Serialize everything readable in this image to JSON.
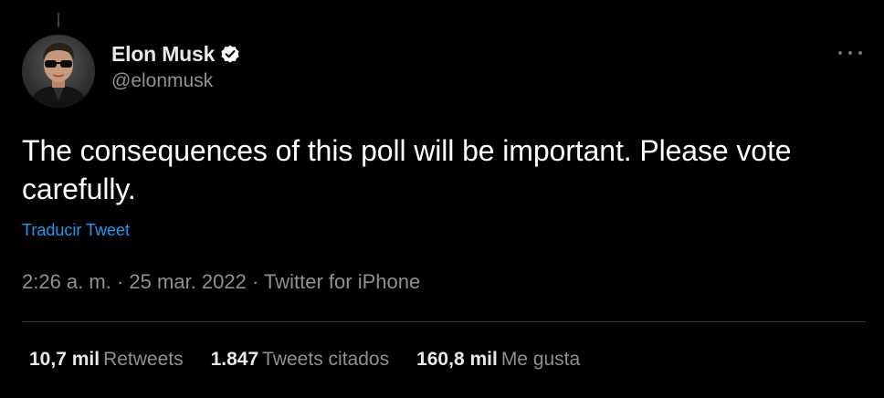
{
  "author": {
    "display_name": "Elon Musk",
    "handle": "@elonmusk",
    "verified": true
  },
  "tweet": {
    "text": "The consequences of this poll will be important. Please vote carefully.",
    "translate_label": "Traducir Tweet",
    "time": "2:26 a. m.",
    "date": "25 mar. 2022",
    "source": "Twitter for iPhone",
    "separator": "·"
  },
  "stats": {
    "retweets_count": "10,7 mil",
    "retweets_label": "Retweets",
    "quotes_count": "1.847",
    "quotes_label": "Tweets citados",
    "likes_count": "160,8 mil",
    "likes_label": "Me gusta"
  },
  "icons": {
    "verified": "verified-badge-icon",
    "more": "more-horizontal-icon"
  },
  "colors": {
    "background": "#000000",
    "text": "#ffffff",
    "muted": "#8b9197",
    "link": "#1d9bf0",
    "divider": "#2f3336"
  }
}
